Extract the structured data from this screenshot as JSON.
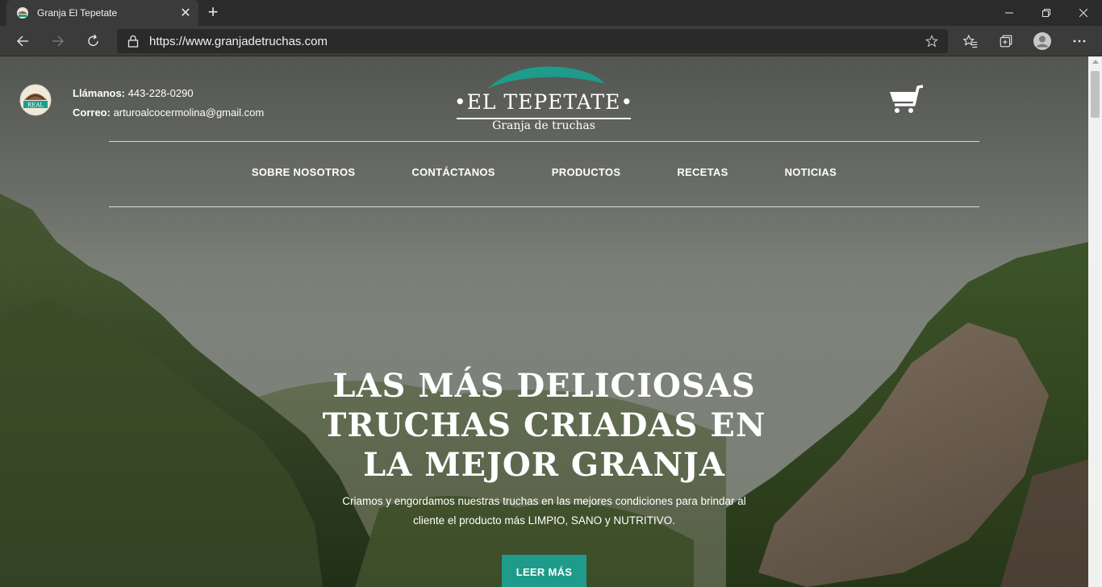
{
  "browser": {
    "tab_title": "Granja El Tepetate",
    "url": "https://www.granjadetruchas.com",
    "icons": [
      "back-icon",
      "forward-icon",
      "refresh-icon",
      "lock-icon",
      "star-icon",
      "favorites-icon",
      "collections-icon",
      "profile-icon",
      "more-icon"
    ]
  },
  "header": {
    "phone_label": "Llámanos:",
    "phone": "443-228-0290",
    "email_label": "Correo:",
    "email": "arturoalcocermolina@gmail.com",
    "logo_title": "•EL TEPETATE•",
    "logo_subtitle": "Granja de truchas",
    "badge_text": "REAL"
  },
  "nav": {
    "items": [
      "SOBRE NOSOTROS",
      "CONTÁCTANOS",
      "PRODUCTOS",
      "RECETAS",
      "NOTICIAS"
    ]
  },
  "hero": {
    "headline_line1": "LAS MÁS DELICIOSAS",
    "headline_line2": "TRUCHAS CRIADAS EN",
    "headline_line3": "LA MEJOR GRANJA",
    "lead_line1": "Criamos y engordamos nuestras truchas en las mejores condiciones para brindar al",
    "lead_line2": "cliente el producto más LIMPIO, SANO y NUTRITIVO.",
    "cta_label": "LEER MÁS"
  },
  "colors": {
    "accent": "#1e9b8a",
    "chrome_bg": "#2b2b2b",
    "toolbar_bg": "#3b3b3b"
  }
}
